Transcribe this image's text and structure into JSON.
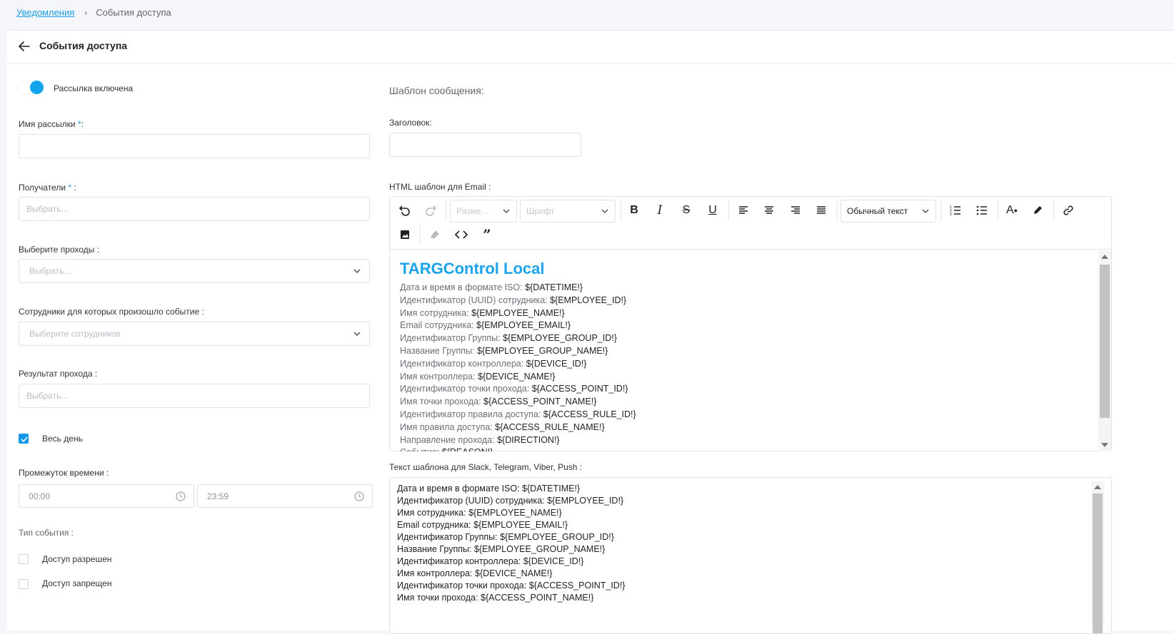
{
  "breadcrumb": {
    "parent": "Уведомления",
    "current": "События доступа"
  },
  "header": {
    "title": "События доступа"
  },
  "left": {
    "toggle_label": "Рассылка включена",
    "name_label": "Имя рассылки ",
    "recipients_label": "Получатели ",
    "recipients_placeholder": "Выбрать...",
    "passages_label": "Выберите проходы :",
    "passages_placeholder": "Выбрать...",
    "employees_label": "Сотрудники для которых произошло событие :",
    "employees_placeholder": "Выберите сотрудников",
    "result_label": "Результат прохода :",
    "result_placeholder": "Выбрать...",
    "allday_label": "Весь день",
    "interval_label": "Промежуток времени :",
    "time_from": "00:00",
    "time_to": "23:59",
    "event_type_label": "Тип события :",
    "event_types": [
      "Доступ разрешен",
      "Доступ запрещен"
    ]
  },
  "right": {
    "template_heading": "Шаблон сообщения:",
    "subject_label": "Заголовок:",
    "html_label": "HTML шаблон для Email :",
    "toolbar": {
      "size": "Разме...",
      "font": "Шрифт",
      "block": "Обычный текст"
    },
    "brand": "TARGControl Local",
    "html_lines": [
      [
        "Дата и время в формате ISO: ",
        "${DATETIME!}"
      ],
      [
        "Идентификатор (UUID) сотрудника: ",
        "${EMPLOYEE_ID!}"
      ],
      [
        "Имя сотрудника: ",
        "${EMPLOYEE_NAME!}"
      ],
      [
        "Email сотрудника: ",
        "${EMPLOYEE_EMAIL!}"
      ],
      [
        "Идентификатор Группы: ",
        "${EMPLOYEE_GROUP_ID!}"
      ],
      [
        "Название Группы: ",
        "${EMPLOYEE_GROUP_NAME!}"
      ],
      [
        "Идентификатор контроллера: ",
        "${DEVICE_ID!}"
      ],
      [
        "Имя контроллера: ",
        "${DEVICE_NAME!}"
      ],
      [
        "Идентификатор точки прохода: ",
        "${ACCESS_POINT_ID!}"
      ],
      [
        "Имя точки прохода: ",
        "${ACCESS_POINT_NAME!}"
      ],
      [
        "Идентификатор правила доступа: ",
        "${ACCESS_RULE_ID!}"
      ],
      [
        "Имя правила доступа: ",
        "${ACCESS_RULE_NAME!}"
      ],
      [
        "Направление прохода: ",
        "${DIRECTION!}"
      ],
      [
        "Событие: ",
        "${REASON!}"
      ]
    ],
    "text_label": "Текст шаблона для Slack, Telegram, Viber, Push :",
    "text_lines": [
      "Дата и время в формате ISO: ${DATETIME!}",
      "Идентификатор (UUID) сотрудника: ${EMPLOYEE_ID!}",
      "Имя сотрудника: ${EMPLOYEE_NAME!}",
      "Email сотрудника: ${EMPLOYEE_EMAIL!}",
      "Идентификатор Группы: ${EMPLOYEE_GROUP_ID!}",
      "Название Группы: ${EMPLOYEE_GROUP_NAME!}",
      "Идентификатор контроллера: ${DEVICE_ID!}",
      "Имя контроллера: ${DEVICE_NAME!}",
      "Идентификатор точки прохода: ${ACCESS_POINT_ID!}",
      "Имя точки прохода: ${ACCESS_POINT_NAME!}"
    ]
  }
}
